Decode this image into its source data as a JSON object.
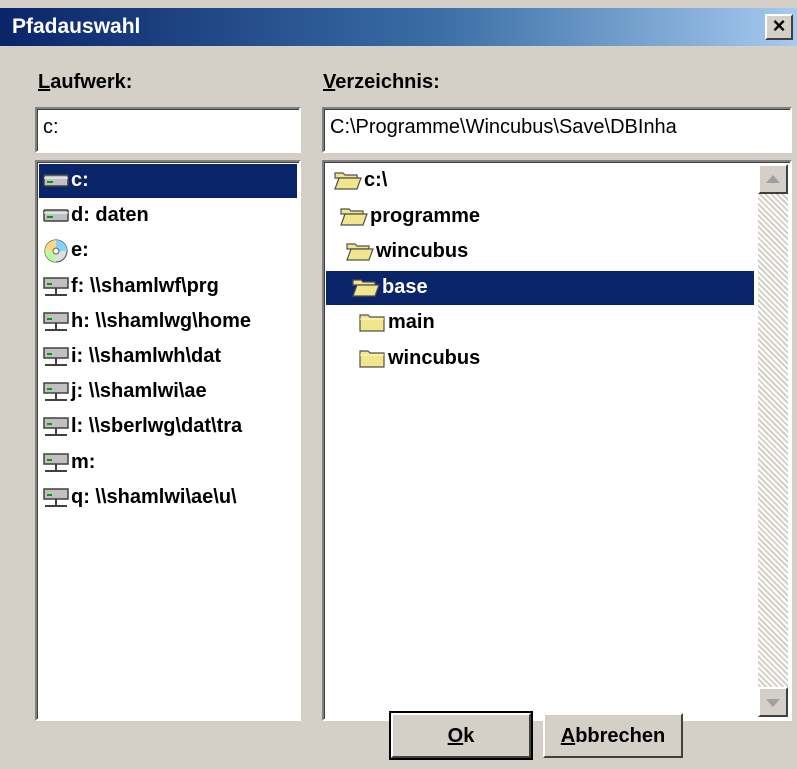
{
  "window": {
    "title": "Pfadauswahl",
    "close_glyph": "×"
  },
  "drive": {
    "label_hotkey": "L",
    "label_rest": "aufwerk:",
    "field_value": "c:",
    "items": [
      {
        "icon": "hard-drive-icon",
        "label": "c:"
      },
      {
        "icon": "hard-drive-icon",
        "label": "d: daten"
      },
      {
        "icon": "cd-drive-icon",
        "label": "e:"
      },
      {
        "icon": "network-drive-icon",
        "label": "f: \\\\shamlwf\\prg"
      },
      {
        "icon": "network-drive-icon",
        "label": "h: \\\\shamlwg\\home"
      },
      {
        "icon": "network-drive-icon",
        "label": "i: \\\\shamlwh\\dat"
      },
      {
        "icon": "network-drive-icon",
        "label": "j: \\\\shamlwi\\ae"
      },
      {
        "icon": "network-drive-icon",
        "label": "l: \\\\sberlwg\\dat\\tra"
      },
      {
        "icon": "network-drive-icon",
        "label": "m:"
      },
      {
        "icon": "network-drive-icon",
        "label": "q: \\\\shamlwi\\ae\\u\\"
      }
    ],
    "selected_index": 0
  },
  "directory": {
    "label_hotkey": "V",
    "label_rest": "erzeichnis:",
    "field_value": "C:\\Programme\\Wincubus\\Save\\DBInha",
    "items": [
      {
        "icon": "open-folder-icon",
        "label": "c:\\"
      },
      {
        "icon": "open-folder-icon",
        "label": "programme"
      },
      {
        "icon": "open-folder-icon",
        "label": "wincubus"
      },
      {
        "icon": "open-folder-icon",
        "label": "base"
      },
      {
        "icon": "closed-folder-icon",
        "label": "main"
      },
      {
        "icon": "closed-folder-icon",
        "label": "wincubus"
      }
    ],
    "selected_index": 3
  },
  "buttons": {
    "ok_hotkey": "O",
    "ok_rest": "k",
    "cancel_hotkey": "A",
    "cancel_rest": "bbrechen"
  },
  "colors": {
    "face": "#d4d0c8",
    "selection": "#0a246a",
    "folder": "#f0e68c"
  }
}
